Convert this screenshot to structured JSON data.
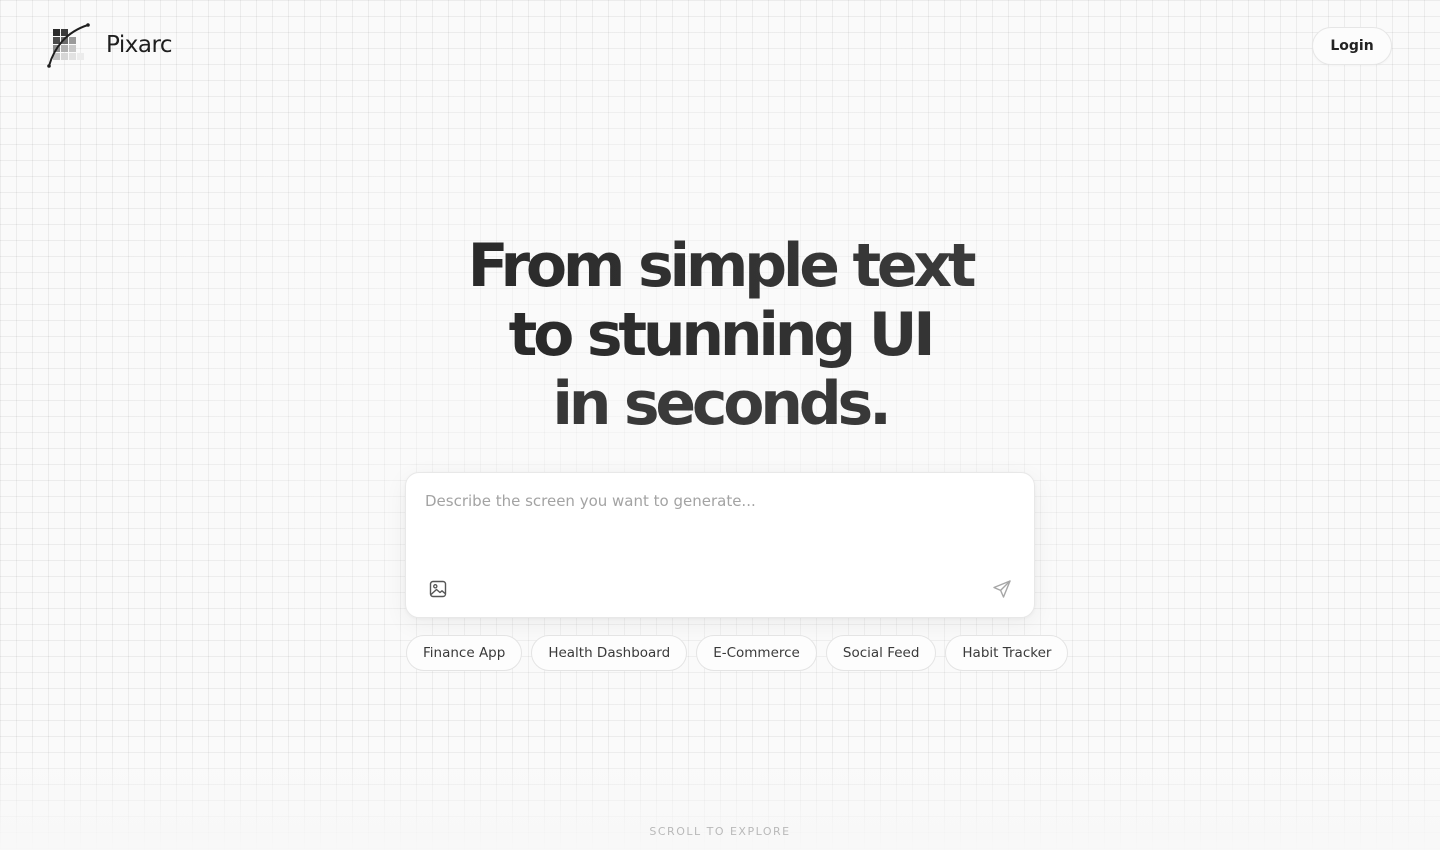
{
  "brand": {
    "name": "Pixarc",
    "logo_icon": "pixel-curve-logo-icon"
  },
  "header": {
    "login_label": "Login"
  },
  "hero": {
    "line1": "From simple text",
    "line2": "to stunning UI",
    "line3": "in seconds."
  },
  "prompt": {
    "placeholder": "Describe the screen you want to generate...",
    "value": "",
    "attach_icon": "image-icon",
    "send_icon": "send-icon"
  },
  "suggestions": [
    "Finance App",
    "Health Dashboard",
    "E-Commerce",
    "Social Feed",
    "Habit Tracker"
  ],
  "footer": {
    "scroll_hint": "SCROLL TO EXPLORE"
  },
  "colors": {
    "background": "#fafafa",
    "text": "#1f1f1f",
    "muted": "#a3a3a3",
    "border": "#e6e6e6"
  }
}
